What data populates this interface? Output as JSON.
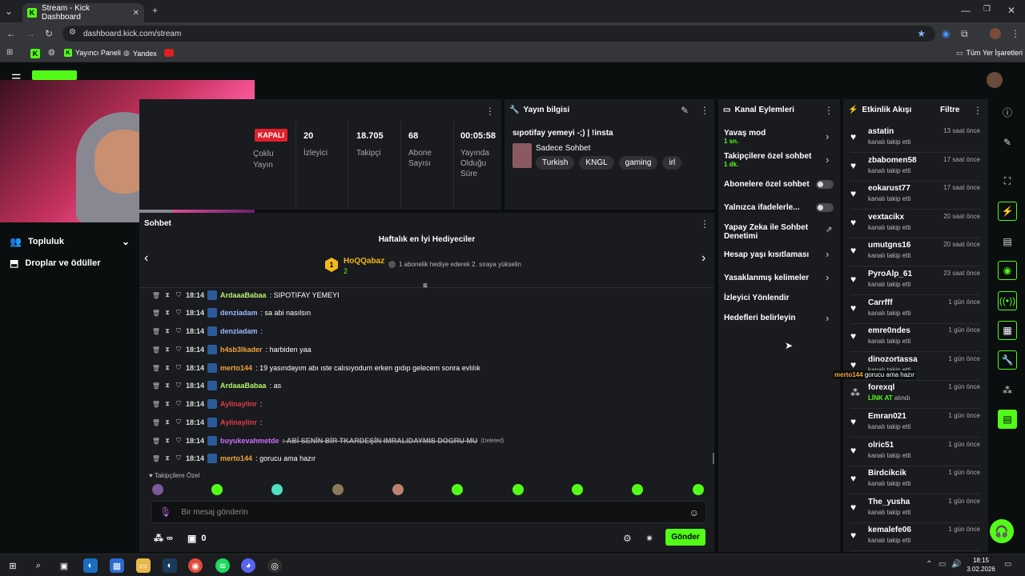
{
  "browser": {
    "tab_title": "Stream - Kick Dashboard",
    "url": "dashboard.kick.com/stream",
    "bookmarks": [
      "Yayıncı Paneli",
      "Yandex"
    ],
    "all_bookmarks": "Tüm Yer İşaretleri"
  },
  "sidebar": {
    "items": [
      {
        "label": "Topluluk"
      },
      {
        "label": "Droplar ve ödüller"
      }
    ]
  },
  "stream_panel": {
    "status": "KAPALI",
    "status_sub": "Çoklu Yayın",
    "stats": [
      {
        "value": "20",
        "label": "İzleyici"
      },
      {
        "value": "18.705",
        "label": "Takipçi"
      },
      {
        "value": "68",
        "label": "Abone Sayısı"
      },
      {
        "value": "00:05:58",
        "label": "Yayında Olduğu Süre"
      }
    ]
  },
  "info_panel": {
    "title": "Yayın bilgisi",
    "stream_title": "sıpotifay yemeyi -;) | !insta",
    "category": "Sadece Sohbet",
    "tags": [
      "Turkish",
      "KNGL",
      "gaming",
      "irl"
    ]
  },
  "chat": {
    "title": "Sohbet",
    "gifters_title": "Haftalık en İyi Hediyeciler",
    "top_gifter": "HoQQabaz",
    "top_gifter_count": "2",
    "gifter_note": "1 abonelik hediye ederek 2. sıraya yükselin",
    "messages": [
      {
        "time": "18:14",
        "user": "ArdaaaBabaa",
        "text": ": SIPOTIFAY YEMEYI",
        "color": "#b6f26c"
      },
      {
        "time": "18:14",
        "user": "denziadam",
        "text": ": sa abi nasılsın",
        "color": "#9ab8ff"
      },
      {
        "time": "18:14",
        "user": "denziadam",
        "text": ":",
        "color": "#9ab8ff"
      },
      {
        "time": "18:14",
        "user": "h4sb3lkader",
        "text": ": harbiden yaa",
        "color": "#f2a33a"
      },
      {
        "time": "18:14",
        "user": "merto144",
        "text": ": 19 yasındayım abı ıste calısıyodum erken gıdıp gelecem sonra evlılık",
        "color": "#f2a33a"
      },
      {
        "time": "18:14",
        "user": "ArdaaaBabaa",
        "text": ": as",
        "color": "#b6f26c"
      },
      {
        "time": "18:14",
        "user": "Aylinaylinr",
        "text": ":",
        "color": "#e03b4b"
      },
      {
        "time": "18:14",
        "user": "Aylinaylinr",
        "text": ":",
        "color": "#e03b4b"
      },
      {
        "time": "18:14",
        "user": "buyukevahmetde",
        "text": ": ABİ SENİN BİR TKARDEŞİN IMRALIDAYMIS DOGRU MU",
        "deleted": "(Deleted)",
        "color": "#cf6bff"
      },
      {
        "time": "18:14",
        "user": "merto144",
        "text": ": gorucu ama hazır",
        "color": "#f2a33a"
      }
    ],
    "follower_only": "Takipçilere Özel",
    "input_placeholder": "Bir mesaj gönderin",
    "send": "Gönder",
    "infinity": "∞",
    "points": "0"
  },
  "channel_actions": {
    "title": "Kanal Eylemleri",
    "items": [
      {
        "label": "Yavaş mod",
        "sub": "1 sn."
      },
      {
        "label": "Takipçilere özel sohbet",
        "sub": "1 dk."
      },
      {
        "label": "Abonelere özel sohbet"
      },
      {
        "label": "Yalnızca ifadelerle..."
      },
      {
        "label": "Yapay Zeka ile Sohbet Denetimi"
      },
      {
        "label": "Hesap yaşı kısıtlaması"
      },
      {
        "label": "Yasaklanmış kelimeler"
      },
      {
        "label": "İzleyici Yönlendir"
      },
      {
        "label": "Hedefleri belirleyin"
      }
    ]
  },
  "activity": {
    "title": "Etkinlik Akışı",
    "filter": "Filtre",
    "events": [
      {
        "name": "astatin",
        "sub": "kanalı takip etti",
        "time": "13 saat önce"
      },
      {
        "name": "zbabomen58",
        "sub": "kanalı takip etti",
        "time": "17 saat önce"
      },
      {
        "name": "eokarust77",
        "sub": "kanalı takip etti",
        "time": "17 saat önce"
      },
      {
        "name": "vextacikx",
        "sub": "kanalı takip etti",
        "time": "20 saat önce"
      },
      {
        "name": "umutgns16",
        "sub": "kanalı takip etti",
        "time": "20 saat önce"
      },
      {
        "name": "PyroAlp_61",
        "sub": "kanalı takip etti",
        "time": "23 saat önce"
      },
      {
        "name": "Carrfff",
        "sub": "kanalı takip etti",
        "time": "1 gün önce"
      },
      {
        "name": "emre0ndes",
        "sub": "kanalı takip etti",
        "time": "1 gün önce"
      },
      {
        "name": "dinozortassa",
        "sub": "kanalı takip etti",
        "time": "1 gün önce"
      },
      {
        "name": "forexql",
        "sub": "LİNK AT",
        "sub2": "alındı",
        "time": "1 gün önce"
      },
      {
        "name": "Emran021",
        "sub": "kanalı takip etti",
        "time": "1 gün önce"
      },
      {
        "name": "olric51",
        "sub": "kanalı takip etti",
        "time": "1 gün önce"
      },
      {
        "name": "Birdcikcik",
        "sub": "kanalı takip etti",
        "time": "1 gün önce"
      },
      {
        "name": "The_yusha",
        "sub": "kanalı takip etti",
        "time": "1 gün önce"
      },
      {
        "name": "kemalefe06",
        "sub": "kanalı takip etti",
        "time": "1 gün önce"
      }
    ],
    "overlay_user": "merto144",
    "overlay_text": "gorucu ama hazır"
  },
  "taskbar": {
    "time": "18:15",
    "date": "3.02.2026"
  }
}
